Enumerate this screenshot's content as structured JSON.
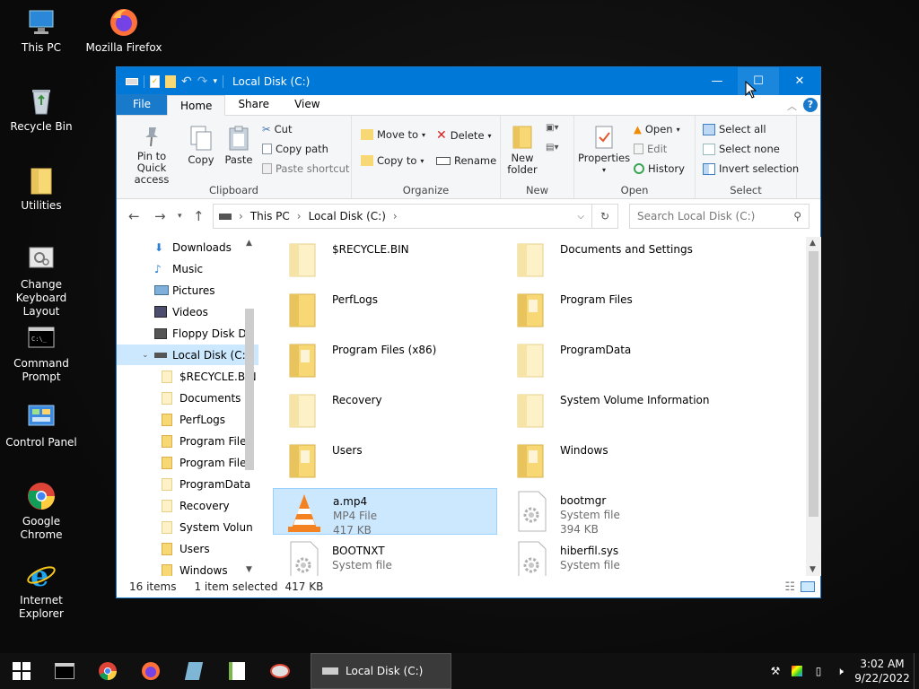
{
  "desktop": {
    "icons": [
      {
        "label": "This PC"
      },
      {
        "label": "Mozilla Firefox"
      },
      {
        "label": "Recycle Bin"
      },
      {
        "label": "Utilities"
      },
      {
        "label": "Change Keyboard Layout"
      },
      {
        "label": "Command Prompt"
      },
      {
        "label": "Control Panel"
      },
      {
        "label": "Google Chrome"
      },
      {
        "label": "Internet Explorer"
      }
    ]
  },
  "window": {
    "title": "Local Disk (C:)",
    "tabs": {
      "file": "File",
      "home": "Home",
      "share": "Share",
      "view": "View"
    },
    "ribbon": {
      "clipboard": {
        "label": "Clipboard",
        "pin": "Pin to Quick access",
        "copy": "Copy",
        "paste": "Paste",
        "cut": "Cut",
        "copy_path": "Copy path",
        "paste_shortcut": "Paste shortcut"
      },
      "organize": {
        "label": "Organize",
        "move_to": "Move to",
        "copy_to": "Copy to",
        "delete": "Delete",
        "rename": "Rename"
      },
      "new": {
        "label": "New",
        "new_folder": "New folder"
      },
      "open": {
        "label": "Open",
        "properties": "Properties",
        "open": "Open",
        "edit": "Edit",
        "history": "History"
      },
      "select": {
        "label": "Select",
        "select_all": "Select all",
        "select_none": "Select none",
        "invert": "Invert selection"
      }
    },
    "address": {
      "segments": [
        "This PC",
        "Local Disk (C:)"
      ],
      "search_placeholder": "Search Local Disk (C:)"
    },
    "nav": [
      {
        "label": "Downloads"
      },
      {
        "label": "Music"
      },
      {
        "label": "Pictures"
      },
      {
        "label": "Videos"
      },
      {
        "label": "Floppy Disk Dri"
      },
      {
        "label": "Local Disk (C:)"
      },
      {
        "label": "$RECYCLE.BIN"
      },
      {
        "label": "Documents a"
      },
      {
        "label": "PerfLogs"
      },
      {
        "label": "Program Files"
      },
      {
        "label": "Program Files"
      },
      {
        "label": "ProgramData"
      },
      {
        "label": "Recovery"
      },
      {
        "label": "System Volun"
      },
      {
        "label": "Users"
      },
      {
        "label": "Windows"
      }
    ],
    "files": [
      {
        "name": "$RECYCLE.BIN",
        "kind": "folder"
      },
      {
        "name": "Documents and Settings",
        "kind": "folder"
      },
      {
        "name": "PerfLogs",
        "kind": "folder"
      },
      {
        "name": "Program Files",
        "kind": "folder"
      },
      {
        "name": "Program Files (x86)",
        "kind": "folder"
      },
      {
        "name": "ProgramData",
        "kind": "folder"
      },
      {
        "name": "Recovery",
        "kind": "folder"
      },
      {
        "name": "System Volume Information",
        "kind": "folder"
      },
      {
        "name": "Users",
        "kind": "folder"
      },
      {
        "name": "Windows",
        "kind": "folder"
      },
      {
        "name": "a.mp4",
        "kind": "vlc",
        "type": "MP4 File",
        "size": "417 KB"
      },
      {
        "name": "bootmgr",
        "kind": "sys",
        "type": "System file",
        "size": "394 KB"
      },
      {
        "name": "BOOTNXT",
        "kind": "sys",
        "type": "System file"
      },
      {
        "name": "hiberfil.sys",
        "kind": "sys",
        "type": "System file"
      }
    ],
    "status": {
      "count": "16 items",
      "selected": "1 item selected",
      "size": "417 KB"
    }
  },
  "taskbar": {
    "active_window": "Local Disk (C:)",
    "time": "3:02 AM",
    "date": "9/22/2022"
  },
  "colors": {
    "accent": "#0078d7",
    "selection": "#cce8ff",
    "folder": "#f8d775"
  }
}
